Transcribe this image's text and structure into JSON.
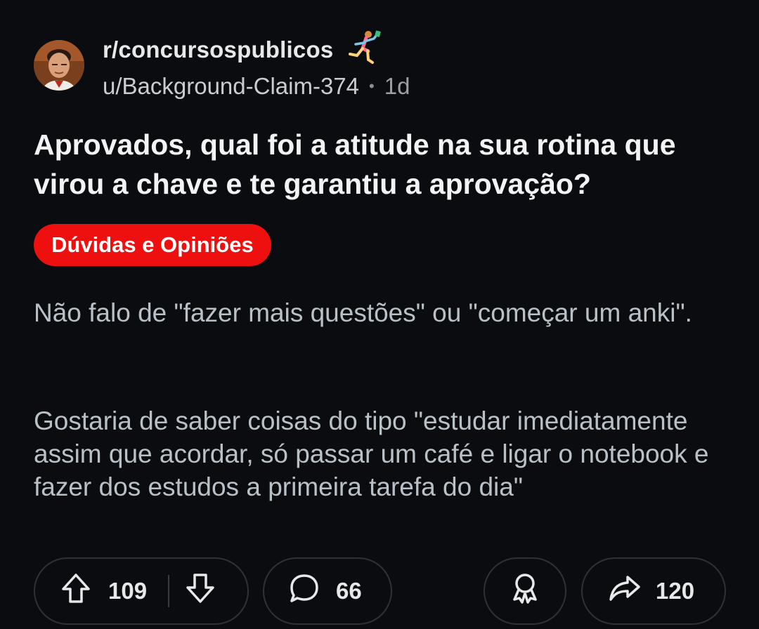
{
  "post": {
    "subreddit": "r/concursospublicos",
    "author": "u/Background-Claim-374",
    "separator": "•",
    "age": "1d",
    "title": "Aprovados, qual foi a atitude na sua rotina que virou a chave e te garantiu a aprovação?",
    "flair": "Dúvidas e Opiniões",
    "body": [
      "Não falo de \"fazer mais questões\" ou \"começar um anki\".",
      "Gostaria de saber coisas do tipo \"estudar imediatamente assim que acordar, só passar um café e ligar o notebook e fazer dos estudos a primeira tarefa do dia\""
    ]
  },
  "actions": {
    "upvotes": "109",
    "comments": "66",
    "shares": "120"
  },
  "icons": {
    "avatar": "avatar-photo",
    "subreddit_badge": "runner-icon",
    "upvote": "arrow-up-icon",
    "downvote": "arrow-down-icon",
    "comment": "speech-bubble-icon",
    "award": "award-icon",
    "share": "share-arrow-icon"
  },
  "colors": {
    "background": "#0b0c0f",
    "flair": "#ee0f0f",
    "pill_border": "#2e3236"
  }
}
